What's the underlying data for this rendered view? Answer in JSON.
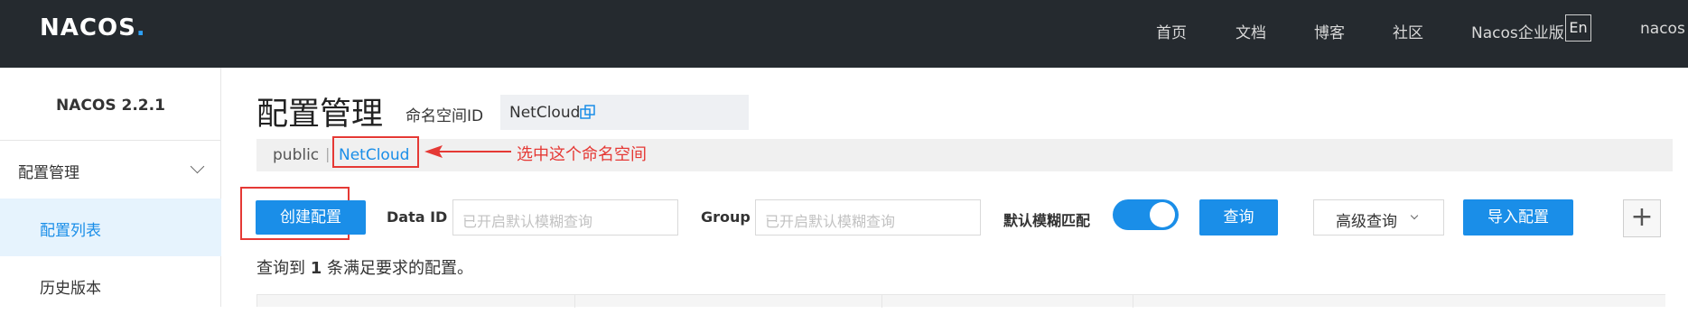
{
  "header": {
    "logo": "NACOS",
    "logo_dot": ".",
    "nav": [
      "首页",
      "文档",
      "博客",
      "社区",
      "Nacos企业版"
    ],
    "lang": "En",
    "user": "nacos"
  },
  "sidebar": {
    "version": "NACOS 2.2.1",
    "group_label": "配置管理",
    "items": [
      "配置列表",
      "历史版本"
    ]
  },
  "main": {
    "title": "配置管理",
    "namespace_label": "命名空间ID",
    "namespace_value": "NetCloud",
    "ns_tabs": [
      "public",
      "NetCloud"
    ],
    "ns_separator": "|",
    "annotation": "选中这个命名空间",
    "create_button": "创建配置",
    "data_id_label": "Data ID",
    "data_id_placeholder": "已开启默认模糊查询",
    "group_label": "Group",
    "group_placeholder": "已开启默认模糊查询",
    "fuzzy_label": "默认模糊匹配",
    "fuzzy_enabled": true,
    "query_button": "查询",
    "advanced_button": "高级查询",
    "import_button": "导入配置",
    "plus_button": "+",
    "result_prefix": "查询到",
    "result_count": "1",
    "result_suffix": "条满足要求的配置。"
  },
  "colors": {
    "accent": "#1a8ee8",
    "header_bg": "#252a2f",
    "annotation_red": "#e53935"
  }
}
